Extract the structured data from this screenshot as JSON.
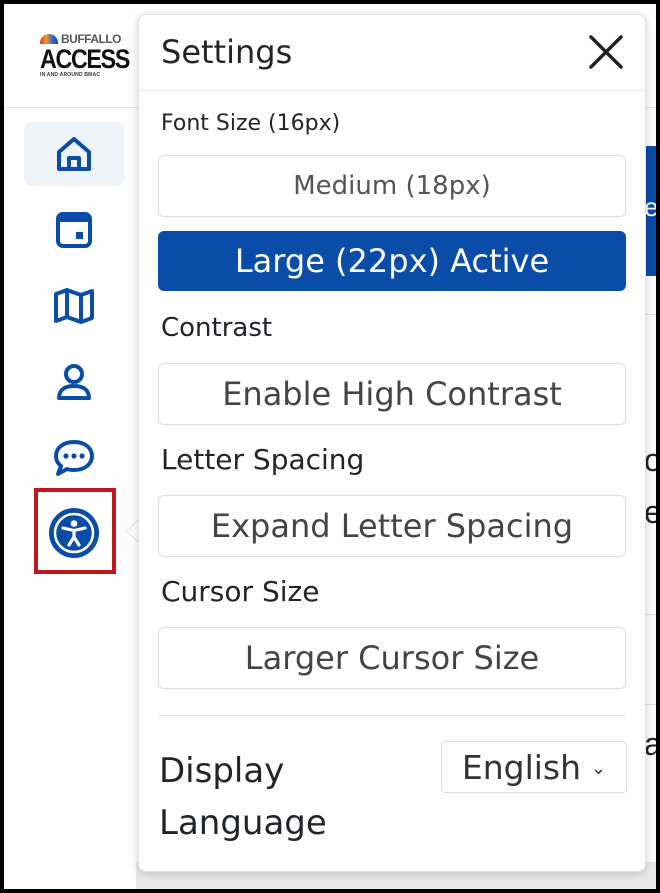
{
  "logo": {
    "top_text": "BUFFALLO",
    "word": "ACCESS",
    "tagline": "IN AND AROUND BMAC"
  },
  "sidebar": {
    "items": [
      {
        "name": "home",
        "icon": "home-icon"
      },
      {
        "name": "calendar",
        "icon": "calendar-icon"
      },
      {
        "name": "map",
        "icon": "map-icon"
      },
      {
        "name": "profile",
        "icon": "user-icon"
      },
      {
        "name": "chat",
        "icon": "chat-icon"
      },
      {
        "name": "accessibility",
        "icon": "accessibility-icon"
      }
    ],
    "accent": "#0a4da8",
    "highlight": "#c0161d"
  },
  "settings": {
    "title": "Settings",
    "close_icon": "close-icon",
    "font_size": {
      "label": "Font Size (16px)",
      "options": [
        {
          "label": "Medium (18px)",
          "active": false
        },
        {
          "label": "Large (22px) Active",
          "active": true
        }
      ]
    },
    "contrast": {
      "label": "Contrast",
      "button": "Enable High Contrast"
    },
    "letter_spacing": {
      "label": "Letter Spacing",
      "button": "Expand Letter Spacing"
    },
    "cursor_size": {
      "label": "Cursor Size",
      "button": "Larger Cursor Size"
    },
    "display_language": {
      "label": "Display Language",
      "selected": "English"
    }
  },
  "background_fragments": {
    "frag1": "e",
    "frag2": "o",
    "frag3": "e",
    "frag4": "a"
  }
}
